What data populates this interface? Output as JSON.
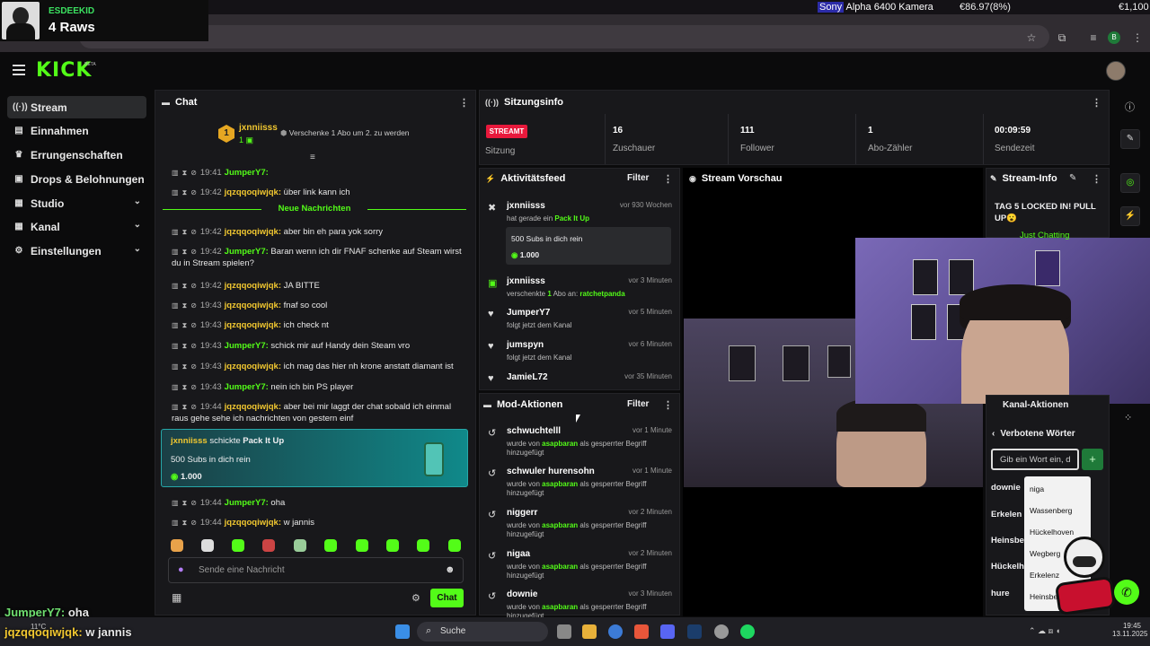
{
  "ticker": {
    "sony_brand": "Sony",
    "sony_text": " Alpha 6400 Kamera",
    "price1": "€86.97(8%)",
    "price2": "€1,100"
  },
  "overlay": {
    "username": "ESDEEKID",
    "raws": "4 Raws"
  },
  "brand": {
    "logo": "KICK",
    "beta": "BETA",
    "accent": "#53fc18"
  },
  "browser": {
    "profile": "B"
  },
  "sidebar": {
    "items": [
      {
        "label": "Stream",
        "icon": "stream-icon",
        "glyph": "((·))"
      },
      {
        "label": "Einnahmen",
        "icon": "earnings-icon",
        "glyph": "▤"
      },
      {
        "label": "Errungenschaften",
        "icon": "trophy-icon",
        "glyph": "🏆"
      },
      {
        "label": "Drops & Belohnungen",
        "icon": "gift-icon",
        "glyph": "▣"
      },
      {
        "label": "Studio",
        "icon": "studio-icon",
        "glyph": "▦"
      },
      {
        "label": "Kanal",
        "icon": "channel-icon",
        "glyph": "▦"
      },
      {
        "label": "Einstellungen",
        "icon": "settings-icon",
        "glyph": "⚙"
      }
    ]
  },
  "chat": {
    "title": "Chat",
    "pinned_user": "jxnniisss",
    "pinned_count": "1",
    "badge_num": "1",
    "gift_offer": "Verschenke 1 Abo um 2. zu werden",
    "new_messages": "Neue Nachrichten",
    "messages": [
      {
        "time": "19:41",
        "user": "JumperY7",
        "text": "",
        "color": "u1"
      },
      {
        "time": "19:42",
        "user": "jqzqqoqiwjqk",
        "text": "über link kann ich",
        "color": "u2"
      },
      {
        "time": "19:42",
        "user": "jqzqqoqiwjqk",
        "text": "aber bin eh para yok sorry",
        "color": "u2"
      },
      {
        "time": "19:42",
        "user": "JumperY7",
        "text": "Baran wenn ich dir FNAF schenke auf Steam wirst du in Stream spielen?",
        "color": "u1"
      },
      {
        "time": "19:42",
        "user": "jqzqqoqiwjqk",
        "text": "JA BITTE",
        "color": "u2"
      },
      {
        "time": "19:43",
        "user": "jqzqqoqiwjqk",
        "text": "fnaf so cool",
        "color": "u2"
      },
      {
        "time": "19:43",
        "user": "jqzqqoqiwjqk",
        "text": "ich check nt",
        "color": "u2"
      },
      {
        "time": "19:43",
        "user": "JumperY7",
        "text": "schick mir auf Handy dein Steam vro",
        "color": "u1"
      },
      {
        "time": "19:43",
        "user": "jqzqqoqiwjqk",
        "text": "ich mag das hier nh krone anstatt diamant ist",
        "color": "u2"
      },
      {
        "time": "19:43",
        "user": "JumperY7",
        "text": "nein ich bin PS player",
        "color": "u1"
      },
      {
        "time": "19:44",
        "user": "jqzqqoqiwjqk",
        "text": "aber bei mir laggt der chat sobald ich einmal raus gehe sehe ich nachrichten von gestern einf",
        "color": "u2"
      },
      {
        "time": "19:44",
        "user": "JumperY7",
        "text": "oha",
        "color": "u1"
      },
      {
        "time": "19:44",
        "user": "jqzqqoqiwjqk",
        "text": "w jannis",
        "color": "u2"
      }
    ],
    "gift": {
      "user": "jxnniisss",
      "action": "schickte",
      "item": "Pack It Up",
      "desc": "500 Subs in dich rein",
      "amount": "1.000"
    },
    "input_placeholder": "Sende eine Nachricht",
    "send_label": "Chat"
  },
  "session": {
    "title": "Sitzungsinfo",
    "status_badge": "STREAMT",
    "status_label": "Sitzung",
    "stats": [
      {
        "value": "16",
        "label": "Zuschauer"
      },
      {
        "value": "111",
        "label": "Follower"
      },
      {
        "value": "1",
        "label": "Abo-Zähler"
      },
      {
        "value": "00:09:59",
        "label": "Sendezeit"
      }
    ]
  },
  "activity": {
    "title": "Aktivitätsfeed",
    "filter": "Filter",
    "items": [
      {
        "name": "jxnniisss",
        "pre": "hat gerade ein ",
        "hl": "Pack It Up",
        "post": "",
        "ago": "vor 930 Wochen"
      },
      {
        "name": "jxnniisss",
        "pre": "verschenkte ",
        "hl": "1",
        "post": " Abo an: ",
        "hl2": "ratchetpanda",
        "ago": "vor 3 Minuten"
      },
      {
        "name": "JumperY7",
        "pre": "folgt jetzt dem Kanal",
        "hl": "",
        "post": "",
        "ago": "vor 5 Minuten"
      },
      {
        "name": "jumspyn",
        "pre": "folgt jetzt dem Kanal",
        "hl": "",
        "post": "",
        "ago": "vor 6 Minuten"
      },
      {
        "name": "JamieL72",
        "pre": "",
        "hl": "",
        "post": "",
        "ago": "vor 35 Minuten"
      }
    ],
    "subbox": {
      "desc": "500 Subs in dich rein",
      "amount": "1.000"
    }
  },
  "mod": {
    "title": "Mod-Aktionen",
    "filter": "Filter",
    "items": [
      {
        "word": "schwuchtelll",
        "ago": "vor 1 Minute"
      },
      {
        "word": "schwuler hurensohn",
        "ago": "vor 1 Minute"
      },
      {
        "word": "niggerr",
        "ago": "vor 2 Minuten"
      },
      {
        "word": "nigaa",
        "ago": "vor 2 Minuten"
      },
      {
        "word": "downie",
        "ago": "vor 3 Minuten"
      }
    ],
    "by_pre": "wurde von ",
    "by_user": "asapbaran",
    "by_post": " als gesperrter Begriff",
    "by_line2": "hinzugefügt"
  },
  "preview": {
    "title": "Stream Vorschau"
  },
  "info": {
    "title": "Stream-Info",
    "stream_title": "TAG 5 LOCKED IN! PULL UP😮",
    "category": "Just Chatting"
  },
  "kanal": {
    "title": "Kanal-Aktionen",
    "section": "Verbotene Wörter",
    "input_placeholder": "Gib ein Wort ein, d",
    "add_label": "+",
    "list": [
      "downie",
      "Erkelen",
      "Heinsbe",
      "Hückelh",
      "hure"
    ],
    "dropdown": [
      "niga",
      "Wassenberg",
      "Hückelhoven",
      "Wegberg",
      "Erkelenz",
      "Heinsberg"
    ]
  },
  "bottom_overlay": {
    "l1_user": "JumperY7:",
    "l1_text": "oha",
    "l2_user": "jqzqqoqiwjqk:",
    "l2_text": "w jannis",
    "weather": "11°C"
  },
  "taskbar": {
    "search": "Suche",
    "time": "19:45",
    "date": "13.11.2025"
  }
}
